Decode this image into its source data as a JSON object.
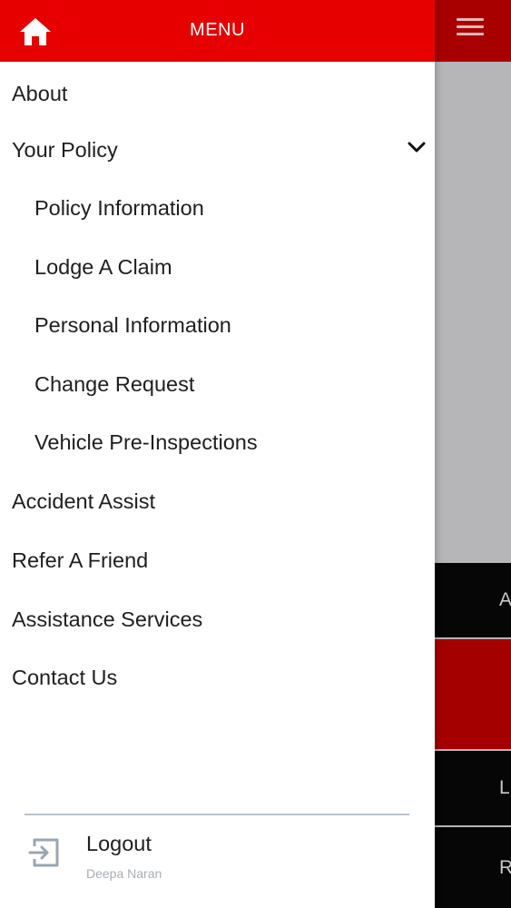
{
  "header": {
    "title": "MENU",
    "home_icon": "home-icon",
    "background_color": "#e60000"
  },
  "menu": {
    "items": [
      {
        "label": "About"
      },
      {
        "label": "Your Policy",
        "expanded": true
      },
      {
        "label": "Policy Information"
      },
      {
        "label": "Lodge A Claim"
      },
      {
        "label": "Personal Information"
      },
      {
        "label": "Change Request"
      },
      {
        "label": "Vehicle Pre-Inspections"
      },
      {
        "label": "Accident Assist"
      },
      {
        "label": "Refer A Friend"
      },
      {
        "label": "Assistance Services"
      },
      {
        "label": "Contact Us"
      }
    ]
  },
  "footer": {
    "logout_label": "Logout",
    "user_name": "Deepa Naran",
    "logout_icon": "logout-icon"
  },
  "background": {
    "hamburger_icon": "hamburger-icon",
    "tiles": [
      {
        "label": "A"
      },
      {
        "label": ""
      },
      {
        "label": "L"
      },
      {
        "label": "R"
      }
    ]
  }
}
